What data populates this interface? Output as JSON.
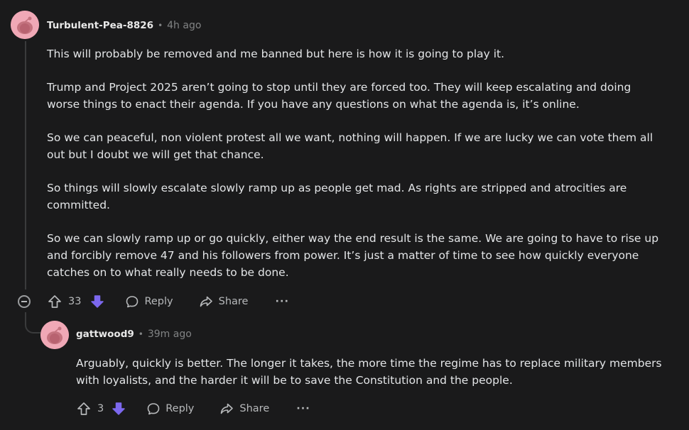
{
  "comment": {
    "username": "Turbulent-Pea-8826",
    "separator": "•",
    "timestamp": "4h ago",
    "paragraphs": [
      "This will probably be removed and me banned but here is how it is going to play it.",
      "Trump and Project 2025 aren’t going to stop until they are forced too. They will keep escalating and doing worse things to enact their agenda. If you have any questions on what the agenda is, it’s online.",
      "So we can peaceful, non violent protest all we want, nothing will happen. If we are lucky we can vote them all out but I doubt we will get that chance.",
      "So things will slowly escalate slowly ramp up as people get mad. As rights are stripped and atrocities are committed.",
      "So we can slowly ramp up or go quickly, either way the end result is the same. We are going to have to rise up and forcibly remove 47 and his followers from power. It’s just a matter of time to see how quickly everyone catches on to what really needs to be done."
    ],
    "score": "33",
    "reply_label": "Reply",
    "share_label": "Share",
    "more_label": "···"
  },
  "reply": {
    "username": "gattwood9",
    "separator": "•",
    "timestamp": "39m ago",
    "paragraphs": [
      "Arguably, quickly is better. The longer it takes, the more time the regime has to replace military members with loyalists, and the harder it will be to save the Constitution and the people."
    ],
    "score": "3",
    "reply_label": "Reply",
    "share_label": "Share",
    "more_label": "···"
  },
  "colors": {
    "background": "#1a1a1b",
    "downvote_active": "#7c68ee",
    "avatar": "#f0a8b6"
  }
}
